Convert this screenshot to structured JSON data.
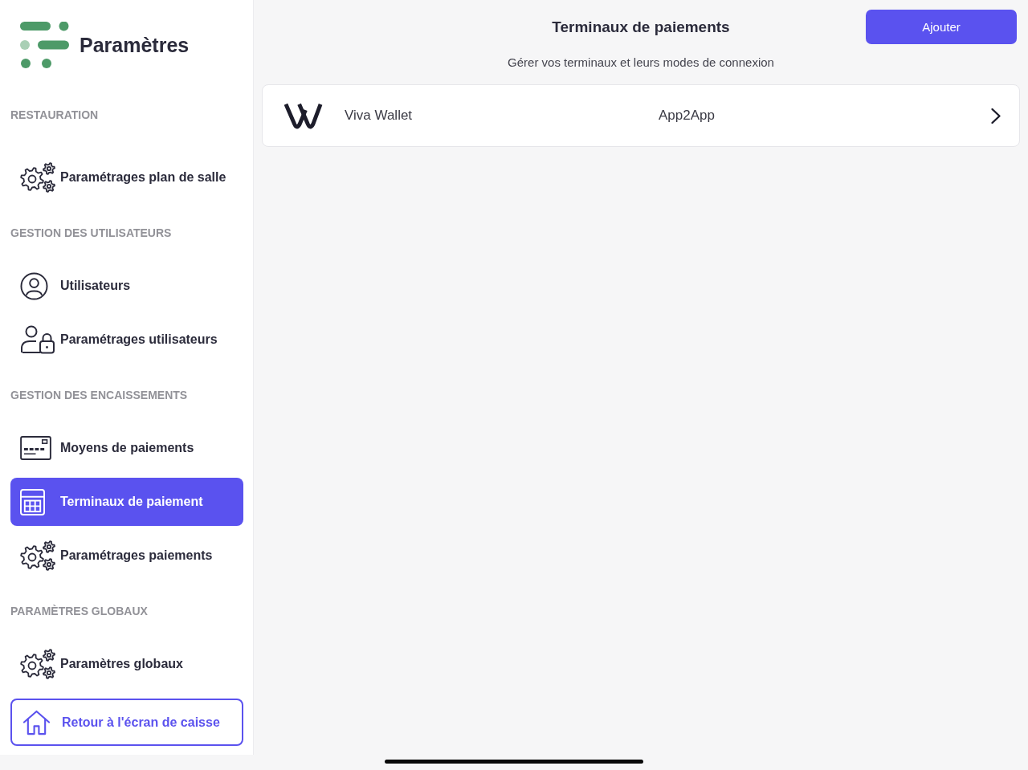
{
  "sidebar": {
    "title": "Paramètres",
    "sections": [
      {
        "heading": "RESTAURATION",
        "items": [
          {
            "label": "Paramétrages plan de salle",
            "selected": false
          }
        ]
      },
      {
        "heading": "GESTION DES UTILISATEURS",
        "items": [
          {
            "label": "Utilisateurs",
            "selected": false
          },
          {
            "label": "Paramétrages utilisateurs",
            "selected": false
          }
        ]
      },
      {
        "heading": "GESTION DES ENCAISSEMENTS",
        "items": [
          {
            "label": "Moyens de paiements",
            "selected": false
          },
          {
            "label": "Terminaux de paiement",
            "selected": true
          },
          {
            "label": "Paramétrages paiements",
            "selected": false
          }
        ]
      },
      {
        "heading": "PARAMÈTRES GLOBAUX",
        "items": [
          {
            "label": "Paramètres globaux",
            "selected": false
          }
        ]
      }
    ],
    "back_button": "Retour à l'écran de caisse"
  },
  "main": {
    "title": "Terminaux de paiements",
    "add_button": "Ajouter",
    "subtitle": "Gérer vos terminaux et leurs modes de connexion",
    "terminals": [
      {
        "name": "Viva Wallet",
        "mode": "App2App"
      }
    ]
  }
}
